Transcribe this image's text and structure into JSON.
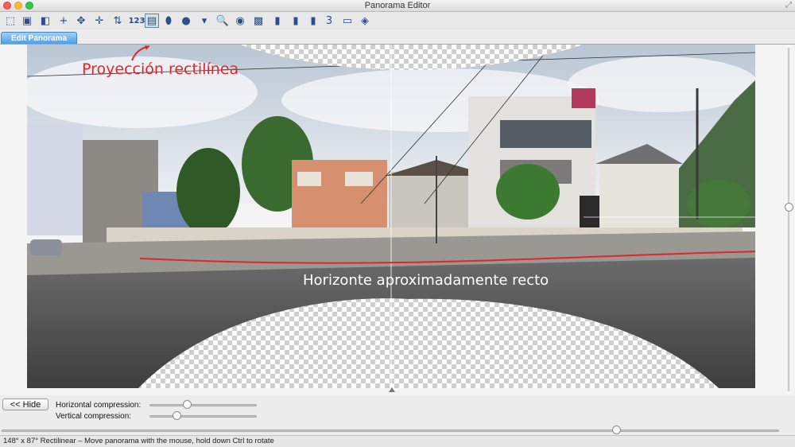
{
  "window": {
    "title": "Panorama Editor"
  },
  "toolbar": {
    "buttons": [
      {
        "icon": "select-arrow-icon",
        "glyph": "⬚"
      },
      {
        "icon": "crop-icon",
        "glyph": "▣"
      },
      {
        "icon": "fit-frame-icon",
        "glyph": "◧"
      },
      {
        "icon": "crosshair-icon",
        "glyph": "+"
      },
      {
        "icon": "move-icon",
        "glyph": "✥"
      },
      {
        "icon": "center-icon",
        "glyph": "✛"
      },
      {
        "icon": "align-icon",
        "glyph": "⇅"
      },
      {
        "icon": "numbers-icon",
        "glyph": "123"
      },
      {
        "icon": "rectilinear-projection-icon",
        "glyph": "▤"
      },
      {
        "icon": "cylindrical-projection-icon",
        "glyph": "⬮"
      },
      {
        "icon": "spherical-projection-icon",
        "glyph": "●"
      },
      {
        "icon": "dropdown-icon",
        "glyph": "▾"
      },
      {
        "icon": "zoom-icon",
        "glyph": "🔍"
      },
      {
        "icon": "preview-eye-icon",
        "glyph": "◉"
      },
      {
        "icon": "frame-icon",
        "glyph": "▩"
      },
      {
        "icon": "page-icon",
        "glyph": "▮"
      },
      {
        "icon": "page-icon",
        "glyph": "▮"
      },
      {
        "icon": "book-icon",
        "glyph": "▮"
      },
      {
        "icon": "counter-icon",
        "glyph": "3"
      },
      {
        "icon": "window-icon",
        "glyph": "▭"
      },
      {
        "icon": "layers-icon",
        "glyph": "◈"
      }
    ]
  },
  "tabs": {
    "edit_panorama": "Edit Panorama"
  },
  "annotations": {
    "projection": "Proyección rectilínea",
    "horizon": "Horizonte aproximadamente recto"
  },
  "controls": {
    "hide_button": "<< Hide",
    "horizontal_compression_label": "Horizontal compression:",
    "vertical_compression_label": "Vertical compression:",
    "horizontal_compression_value": 0.35,
    "vertical_compression_value": 0.25,
    "vertical_scroll_value": 0.47,
    "horizontal_scroll_value": 0.79
  },
  "status": {
    "text": "148° x 87° Rectilinear – Move panorama with the mouse, hold down Ctrl to rotate"
  },
  "colors": {
    "annotation_red": "#e0262b",
    "tab_blue": "#4c9fe8"
  }
}
